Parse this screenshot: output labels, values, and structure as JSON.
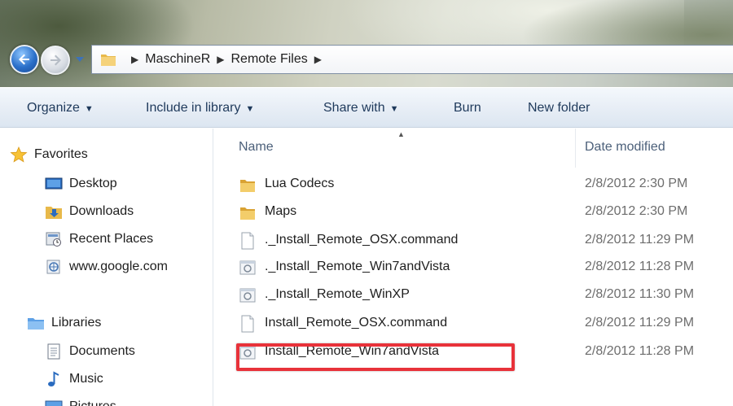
{
  "window": {
    "breadcrumb": [
      "MaschineR",
      "Remote Files"
    ]
  },
  "toolbar": {
    "organize": "Organize",
    "include_in_library": "Include in library",
    "share_with": "Share with",
    "burn": "Burn",
    "new_folder": "New folder"
  },
  "nav": {
    "favorites": {
      "label": "Favorites",
      "items": [
        "Desktop",
        "Downloads",
        "Recent Places",
        "www.google.com"
      ]
    },
    "libraries": {
      "label": "Libraries",
      "items": [
        "Documents",
        "Music",
        "Pictures"
      ]
    }
  },
  "columns": {
    "name": "Name",
    "date_modified": "Date modified"
  },
  "files": [
    {
      "name": "Lua Codecs",
      "date": "2/8/2012 2:30 PM",
      "icon": "folder-icon"
    },
    {
      "name": "Maps",
      "date": "2/8/2012 2:30 PM",
      "icon": "folder-icon"
    },
    {
      "name": "._Install_Remote_OSX.command",
      "date": "2/8/2012 11:29 PM",
      "icon": "file-icon"
    },
    {
      "name": "._Install_Remote_Win7andVista",
      "date": "2/8/2012 11:28 PM",
      "icon": "executable-icon"
    },
    {
      "name": "._Install_Remote_WinXP",
      "date": "2/8/2012 11:30 PM",
      "icon": "executable-icon"
    },
    {
      "name": "Install_Remote_OSX.command",
      "date": "2/8/2012 11:29 PM",
      "icon": "file-icon"
    },
    {
      "name": "Install_Remote_Win7andVista",
      "date": "2/8/2012 11:28 PM",
      "icon": "executable-icon"
    }
  ],
  "colors": {
    "highlight": "#e8323a",
    "toolbar_text": "#1e395b",
    "column_header": "#4c607a"
  }
}
